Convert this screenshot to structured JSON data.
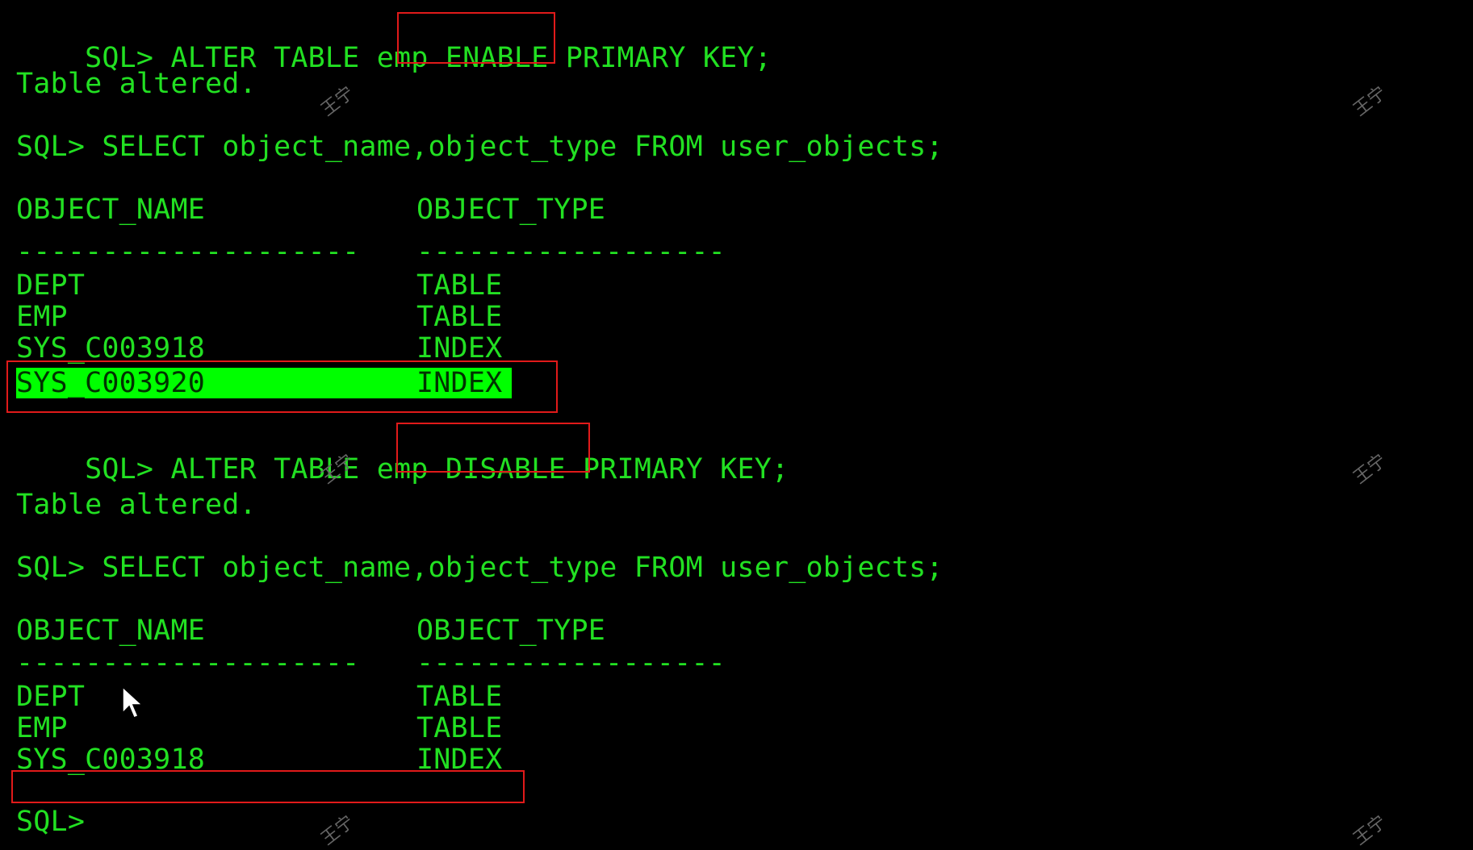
{
  "terminal": {
    "lines": [
      {
        "id": "cmd-enable",
        "parts": [
          "SQL> ALTER TABLE emp ",
          "ENABLE ",
          "PRIMARY KEY;"
        ]
      },
      {
        "id": "result-1",
        "text": "Table altered."
      },
      {
        "id": "cmd-select-1",
        "text": "SQL> SELECT object_name,object_type FROM user_objects;"
      },
      {
        "id": "header-1",
        "name": "OBJECT_NAME",
        "type": "OBJECT_TYPE"
      },
      {
        "id": "sep-1",
        "name": "--------------------",
        "type": "------------------"
      },
      {
        "id": "row-1-1",
        "name": "DEPT",
        "type": "TABLE"
      },
      {
        "id": "row-1-2",
        "name": "EMP",
        "type": "TABLE"
      },
      {
        "id": "row-1-3",
        "name": "SYS_C003918",
        "type": "INDEX"
      },
      {
        "id": "row-1-4",
        "name": "SYS_C003920",
        "type": "INDEX",
        "highlighted": true
      },
      {
        "id": "cmd-disable",
        "parts": [
          "SQL> ALTER TABLE emp ",
          "DISABLE ",
          "PRIMARY KEY;"
        ]
      },
      {
        "id": "result-2",
        "text": "Table altered."
      },
      {
        "id": "cmd-select-2",
        "text": "SQL> SELECT object_name,object_type FROM user_objects;"
      },
      {
        "id": "header-2",
        "name": "OBJECT_NAME",
        "type": "OBJECT_TYPE"
      },
      {
        "id": "sep-2",
        "name": "--------------------",
        "type": "------------------"
      },
      {
        "id": "row-2-1",
        "name": "DEPT",
        "type": "TABLE"
      },
      {
        "id": "row-2-2",
        "name": "EMP",
        "type": "TABLE"
      },
      {
        "id": "row-2-3",
        "name": "SYS_C003918",
        "type": "INDEX"
      },
      {
        "id": "prompt",
        "text": "SQL>"
      }
    ]
  },
  "watermark_text": "王宁",
  "colors": {
    "background": "#000000",
    "text": "#22e022",
    "highlight": "#00ff00",
    "annotation_box": "#e11a1a"
  }
}
